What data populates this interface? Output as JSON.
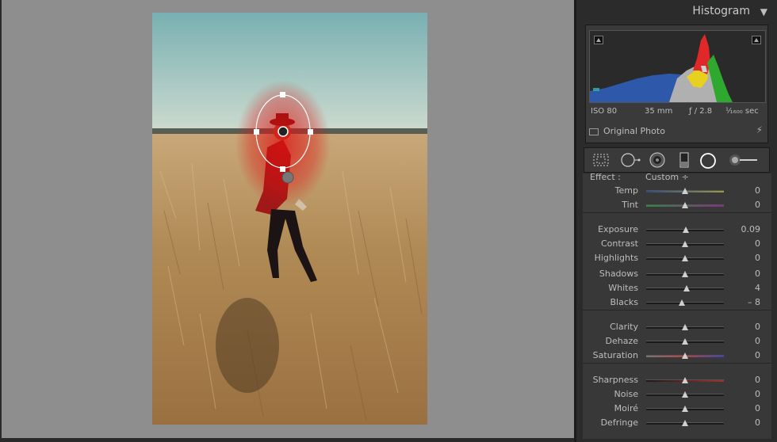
{
  "histogram": {
    "title": "Histogram",
    "iso": "ISO 80",
    "focal": "35 mm",
    "aperture": "ƒ / 2.8",
    "shutter": "¹⁄₁₆₀₀ sec",
    "original_photo_label": "Original Photo"
  },
  "tools": [
    "crop-overlay-icon",
    "spot-removal-icon",
    "red-eye-icon",
    "graduated-filter-icon",
    "radial-filter-icon",
    "adjustment-brush-icon"
  ],
  "effect": {
    "label": "Effect :",
    "value": "Custom ÷"
  },
  "adjustments": [
    {
      "label": "Temp",
      "value": "0",
      "pos": 0.5,
      "group": 0,
      "track": "temp"
    },
    {
      "label": "Tint",
      "value": "0",
      "pos": 0.5,
      "group": 0,
      "track": "tint"
    },
    {
      "label": "Exposure",
      "value": "0.09",
      "pos": 0.51,
      "group": 1,
      "track": "plain"
    },
    {
      "label": "Contrast",
      "value": "0",
      "pos": 0.5,
      "group": 1,
      "track": "plain"
    },
    {
      "label": "Highlights",
      "value": "0",
      "pos": 0.5,
      "group": 1,
      "track": "plain"
    },
    {
      "label": "Shadows",
      "value": "0",
      "pos": 0.5,
      "group": 1,
      "track": "plain"
    },
    {
      "label": "Whites",
      "value": "4",
      "pos": 0.52,
      "group": 1,
      "track": "plain"
    },
    {
      "label": "Blacks",
      "value": "– 8",
      "pos": 0.46,
      "group": 1,
      "track": "plain"
    },
    {
      "label": "Clarity",
      "value": "0",
      "pos": 0.5,
      "group": 2,
      "track": "plain"
    },
    {
      "label": "Dehaze",
      "value": "0",
      "pos": 0.5,
      "group": 2,
      "track": "plain"
    },
    {
      "label": "Saturation",
      "value": "0",
      "pos": 0.5,
      "group": 2,
      "track": "sat"
    },
    {
      "label": "Sharpness",
      "value": "0",
      "pos": 0.5,
      "group": 3,
      "track": "sharp"
    },
    {
      "label": "Noise",
      "value": "0",
      "pos": 0.5,
      "group": 3,
      "track": "plain"
    },
    {
      "label": "Moiré",
      "value": "0",
      "pos": 0.5,
      "group": 3,
      "track": "plain"
    },
    {
      "label": "Defringe",
      "value": "0",
      "pos": 0.5,
      "group": 3,
      "track": "plain"
    }
  ],
  "colors": {
    "panel_bg": "#2b2b2b",
    "mask_overlay": "#e01010"
  }
}
